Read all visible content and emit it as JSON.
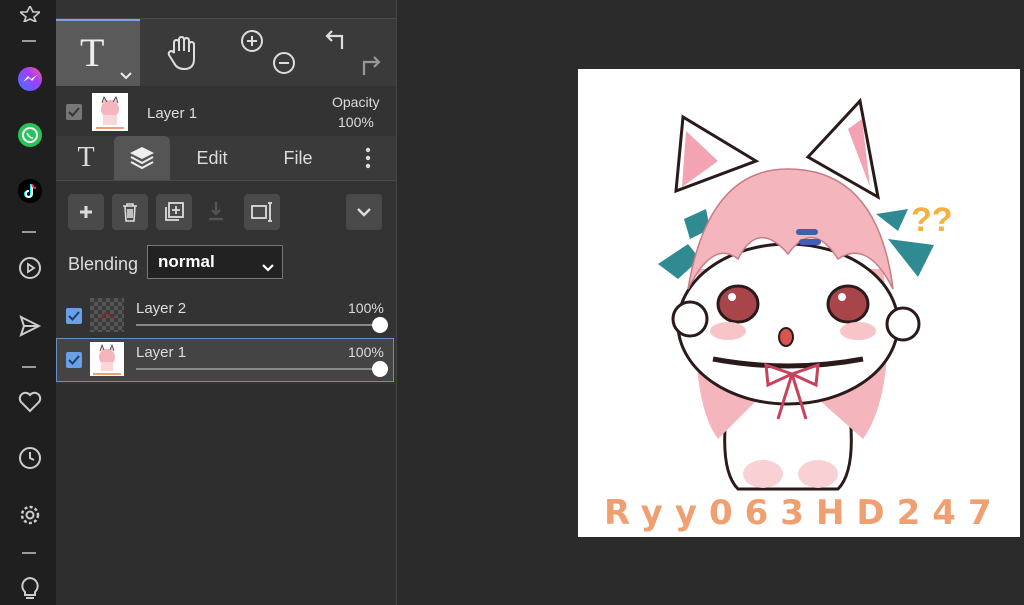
{
  "sidebar": {
    "icons": [
      "star-icon",
      "messenger-icon",
      "whatsapp-icon",
      "tiktok-icon",
      "play-circle-icon",
      "send-icon",
      "heart-icon",
      "clock-icon",
      "gear-icon",
      "lightbulb-icon"
    ]
  },
  "toolbar": {
    "text_tool_label": "T",
    "tools": [
      "text-tool",
      "hand-tool",
      "zoom-in",
      "zoom-out",
      "undo",
      "redo"
    ]
  },
  "active_layer": {
    "name": "Layer 1",
    "opacity_label": "Opacity",
    "opacity_value": "100%"
  },
  "tabs": {
    "text": "T",
    "edit": "Edit",
    "file": "File"
  },
  "blending": {
    "label": "Blending",
    "value": "normal"
  },
  "layers": [
    {
      "name": "Layer 2",
      "opacity": "100%",
      "checked": true,
      "selected": false
    },
    {
      "name": "Layer 1",
      "opacity": "100%",
      "checked": true,
      "selected": true
    }
  ],
  "canvas": {
    "watermark": "Ryy063HD247"
  },
  "colors": {
    "accent": "#6aa0e8",
    "watermark": "#f0a070"
  }
}
